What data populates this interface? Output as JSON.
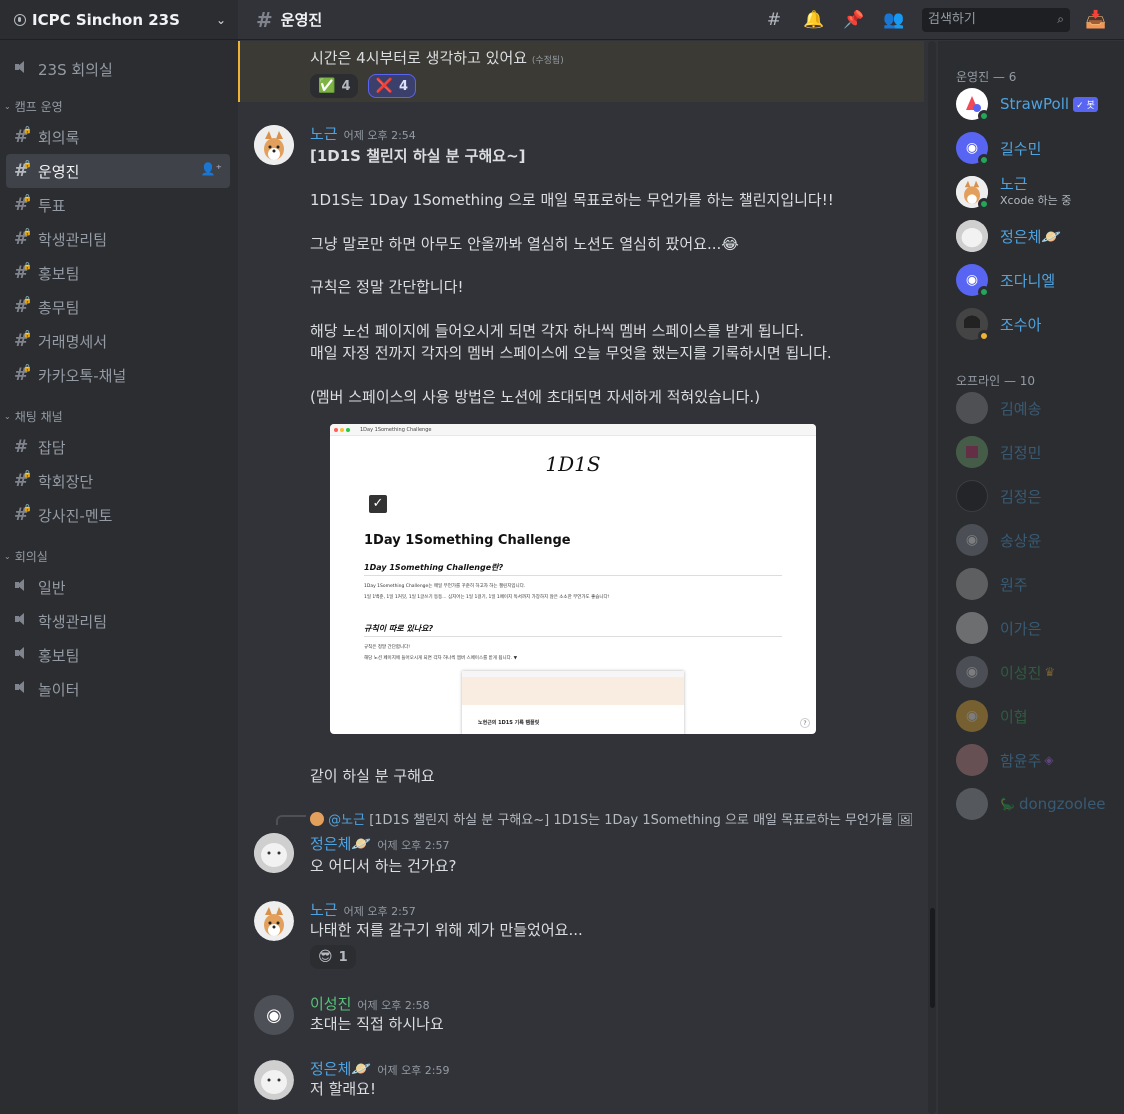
{
  "guild": {
    "name": "ICPC Sinchon 23S"
  },
  "sidebar": {
    "top_channels": [
      {
        "label": "23S 회의실"
      }
    ],
    "categories": [
      {
        "label": "캠프 운영",
        "channels": [
          {
            "label": "회의록"
          },
          {
            "label": "운영진"
          },
          {
            "label": "투표"
          },
          {
            "label": "학생관리팀"
          },
          {
            "label": "홍보팀"
          },
          {
            "label": "총무팀"
          },
          {
            "label": "거래명세서"
          },
          {
            "label": "카카오톡-채널"
          }
        ]
      },
      {
        "label": "채팅 채널",
        "channels": [
          {
            "label": "잡담"
          },
          {
            "label": "학회장단"
          },
          {
            "label": "강사진-멘토"
          }
        ]
      },
      {
        "label": "회의실",
        "channels": [
          {
            "label": "일반"
          },
          {
            "label": "학생관리팀"
          },
          {
            "label": "홍보팀"
          },
          {
            "label": "놀이터"
          }
        ]
      }
    ]
  },
  "header": {
    "channel": "운영진",
    "search_placeholder": "검색하기"
  },
  "chat": {
    "prev_message": {
      "text": "시간은 4시부터로 생각하고 있어요",
      "edited": "(수정됨)",
      "reactions": [
        {
          "emoji": "✅",
          "count": "4"
        },
        {
          "emoji": "❌",
          "count": "4"
        }
      ]
    },
    "messages": [
      {
        "author": "노근",
        "time": "어제 오후 2:54",
        "lines": [
          "[1D1S 챌린지 하실 분 구해요~]",
          "1D1S는 1Day 1Something 으로 매일 목표로하는 무언가를 하는 챌린지입니다!!",
          "그냥 말로만 하면 아무도 안올까봐 열심히 노션도 열심히 팠어요...",
          "규칙은 정말 간단합니다!",
          "해당 노선 페이지에 들어오시게 되면 각자 하나씩 멤버 스페이스를 받게 됩니다.",
          "매일 자정 전까지 각자의 멤버 스페이스에 오늘 무엇을 했는지를 기록하시면 됩니다.",
          "(멤버 스페이스의 사용 방법은 노션에 초대되면 자세하게 적혀있습니다.)",
          "같이 하실 분 구해요"
        ],
        "emoji": "😂",
        "embed": {
          "browser_title": "1Day 1Something Challenge",
          "logo": "1D1S",
          "title": "1Day 1Something Challenge",
          "h2a": "1Day 1Something Challenge란?",
          "p1": "1Day 1Something Challenge는 매일 무언가를 꾸준히 하고자 하는 챌린지입니다.",
          "p2": "1일 1백준, 1일 1커밋, 1일 1글쓰기 등등... 심지어는 1일 1걸기, 1일 1페이지 독서까지 가장하지 않은 소소한 무언가도 좋습니다!",
          "h2b": "규칙이 따로 있나요?",
          "p3": "규칙은 정말 간단합니다!",
          "p4": "해당 노션 페이지에 들어오시게 되면 각자 하나씩 멤버 스페이스를 받게 됩니다. ▼",
          "inner_title": "노현근의 1D1S 기록 템플릿",
          "help": "?"
        }
      },
      {
        "reply_to": {
          "mention": "@노근",
          "text": "[1D1S 챌린지 하실 분 구해요~] 1D1S는 1Day 1Something 으로 매일 목표로하는 무언가를"
        },
        "author": "정은체",
        "time": "어제 오후 2:57",
        "text": "오 어디서 하는 건가요?"
      },
      {
        "author": "노근",
        "time": "어제 오후 2:57",
        "text": "나태한 저를 갈구기 위해 제가 만들었어요...",
        "reactions": [
          {
            "emoji": "😎",
            "count": "1"
          }
        ]
      },
      {
        "author": "이성진",
        "time": "어제 오후 2:58",
        "text": "초대는 직접 하시나요"
      },
      {
        "author": "정은체",
        "time": "어제 오후 2:59",
        "text": "저 할래요!"
      }
    ]
  },
  "members": {
    "online_header": "운영진 — 6",
    "offline_header": "오프라인 — 10",
    "online": [
      {
        "name": "StrawPoll",
        "badge": "✓ 봇"
      },
      {
        "name": "길수민"
      },
      {
        "name": "노근",
        "activity": "Xcode 하는 중"
      },
      {
        "name": "정은체"
      },
      {
        "name": "조다니엘"
      },
      {
        "name": "조수아"
      }
    ],
    "offline": [
      {
        "name": "김예송"
      },
      {
        "name": "김정민"
      },
      {
        "name": "김정은"
      },
      {
        "name": "송상윤"
      },
      {
        "name": "원주"
      },
      {
        "name": "이가은"
      },
      {
        "name": "이성진"
      },
      {
        "name": "이협"
      },
      {
        "name": "함윤주"
      },
      {
        "name": "dongzoolee"
      }
    ]
  },
  "colors": {
    "accent": "#5865f2",
    "online": "#23a55a",
    "idle": "#f0b232",
    "name_blue": "#4fa3e0",
    "name_green": "#57c47a",
    "name_green_dark": "#3ba55d"
  }
}
